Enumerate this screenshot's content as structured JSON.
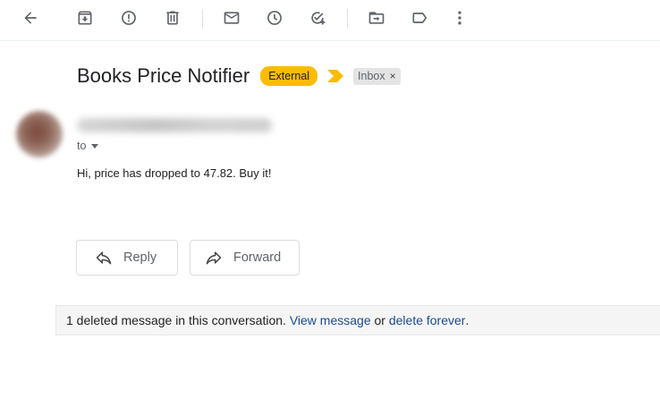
{
  "subject": "Books Price Notifier",
  "labels": {
    "external": "External",
    "inbox": "Inbox",
    "remove": "×"
  },
  "message": {
    "to_label": "to",
    "body": "Hi, price has dropped to 47.82. Buy it!"
  },
  "actions": {
    "reply": "Reply",
    "forward": "Forward"
  },
  "notice": {
    "prefix": "1 deleted message in this conversation. ",
    "view_link": "View message",
    "middle": " or ",
    "delete_link": "delete forever",
    "suffix": "."
  },
  "toolbar_icons": [
    "back-arrow-icon",
    "archive-icon",
    "report-spam-icon",
    "delete-icon",
    "mark-unread-icon",
    "snooze-icon",
    "add-to-tasks-icon",
    "move-to-icon",
    "label-icon",
    "more-options-icon"
  ],
  "colors": {
    "external_badge": "#fbbc04",
    "importance_marker": "#fbbc04",
    "link": "#1a4b8e",
    "inbox_badge": "#e4e4e4"
  }
}
